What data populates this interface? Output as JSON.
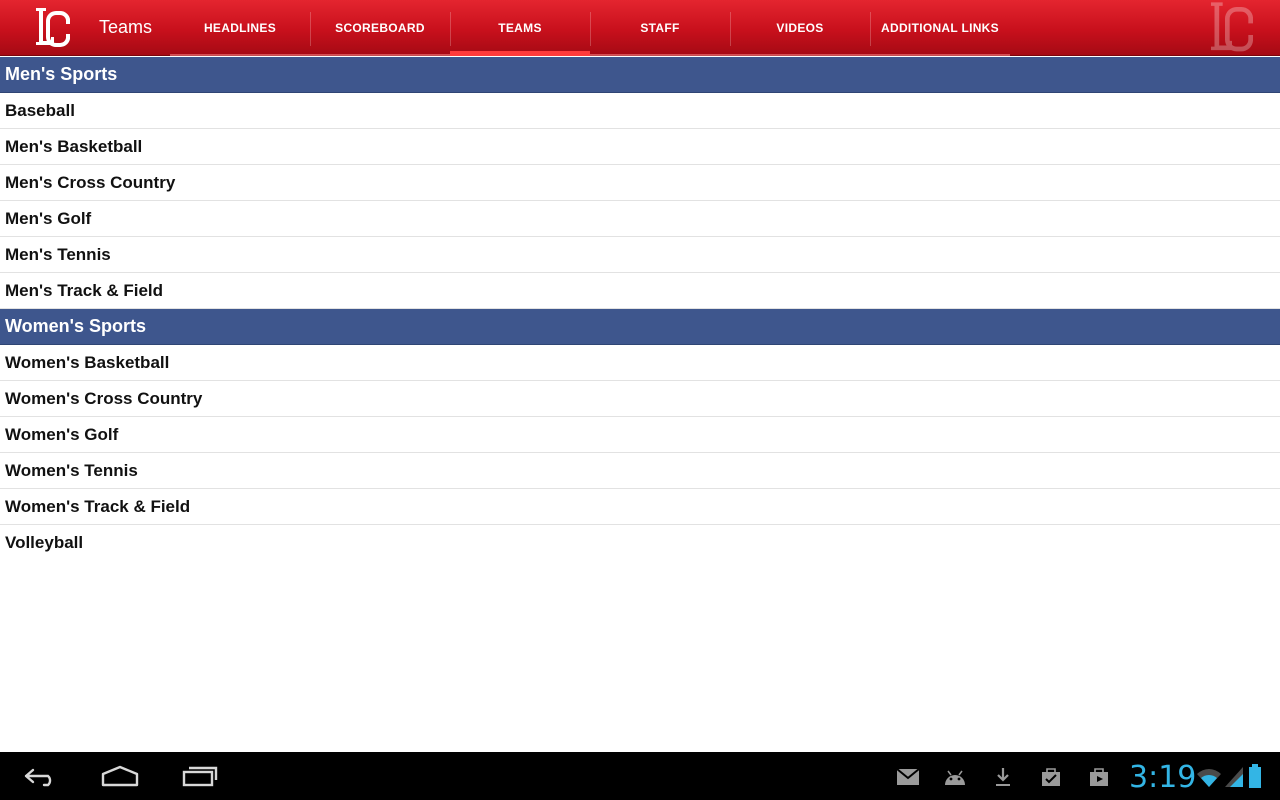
{
  "actionbar": {
    "logo_text": "LC",
    "title": "Teams",
    "tabs": [
      {
        "label": "HEADLINES",
        "active": false
      },
      {
        "label": "SCOREBOARD",
        "active": false
      },
      {
        "label": "TEAMS",
        "active": true
      },
      {
        "label": "STAFF",
        "active": false
      },
      {
        "label": "VIDEOS",
        "active": false
      },
      {
        "label": "ADDITIONAL LINKS",
        "active": false
      }
    ]
  },
  "sections": [
    {
      "header": "Men's Sports",
      "items": [
        "Baseball",
        "Men's Basketball",
        "Men's Cross Country",
        "Men's Golf",
        "Men's Tennis",
        "Men's Track & Field"
      ]
    },
    {
      "header": "Women's Sports",
      "items": [
        "Women's Basketball",
        "Women's Cross Country",
        "Women's Golf",
        "Women's Tennis",
        "Women's Track & Field",
        "Volleyball"
      ]
    }
  ],
  "systembar": {
    "nav_icons": [
      "back-icon",
      "home-icon",
      "recent-apps-icon"
    ],
    "notification_icons": [
      "gmail-icon",
      "android-icon",
      "download-icon",
      "store-update-icon",
      "play-update-icon"
    ],
    "clock": "3:19",
    "status_icons": [
      "wifi-icon",
      "signal-icon",
      "battery-icon"
    ]
  },
  "colors": {
    "actionbar_red": "#c8101c",
    "section_blue": "#3e568d",
    "clock_blue": "#33b5e5"
  }
}
